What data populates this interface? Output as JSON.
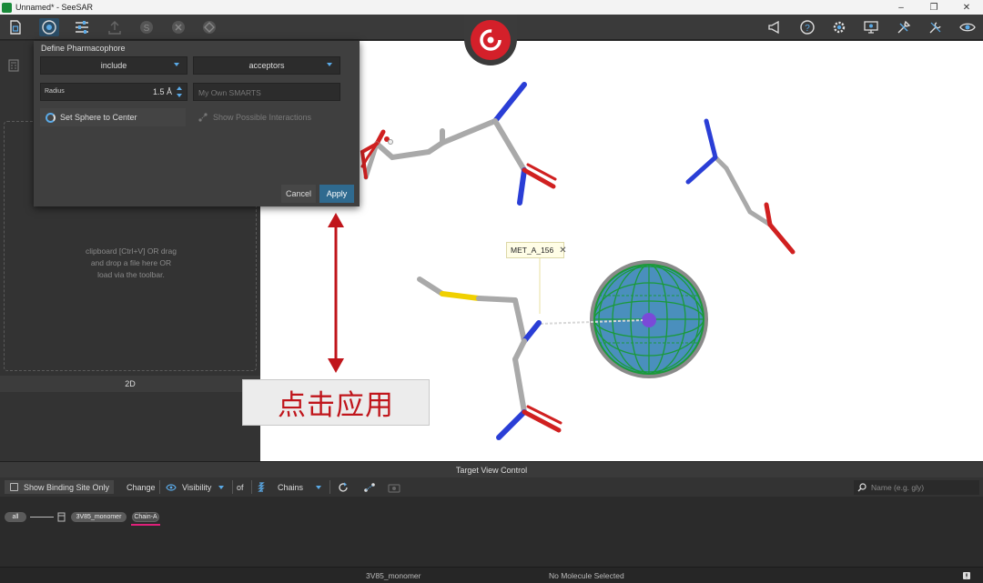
{
  "window": {
    "title": "Unnamed* - SeeSAR",
    "controls": [
      "–",
      "❐",
      "✕"
    ]
  },
  "toolbar": {
    "left_icons": [
      "file-icon",
      "pharmacophore-icon",
      "settings-sliders-icon",
      "upload-icon",
      "dollar-icon",
      "delete-icon",
      "diamond-icon"
    ],
    "right_icons": [
      "announce-icon",
      "help-icon",
      "gear-icon",
      "monitor-icon",
      "tools-icon",
      "wrench-icon",
      "eye-icon"
    ],
    "active_icon": "pharmacophore-icon"
  },
  "dialog": {
    "title": "Define Pharmacophore",
    "mode_dropdown": "include",
    "type_dropdown": "acceptors",
    "radius_label": "Radius",
    "radius_value": "1.5 Å",
    "smarts_placeholder": "My Own SMARTS",
    "sphere_button": "Set Sphere to Center",
    "interactions_button": "Show Possible Interactions",
    "cancel": "Cancel",
    "apply": "Apply"
  },
  "left_panel": {
    "drop_text": [
      "clipboard [Ctrl+V] OR drag",
      "and drop a file here OR",
      "load via the toolbar."
    ],
    "label_2d": "2D"
  },
  "viewport": {
    "residue_label": "MET_A_156",
    "close": "✕"
  },
  "annotation": {
    "text": "点击应用",
    "color": "#c0151b"
  },
  "target_view": {
    "header": "Target View Control",
    "show_binding_site": "Show Binding Site Only",
    "change": "Change",
    "visibility": "Visibility",
    "of": "of",
    "chains": "Chains",
    "search_placeholder": "Name (e.g. gly)",
    "tree": {
      "all": "all",
      "monomer": "3V85_monomer",
      "chain": "Chain-A"
    }
  },
  "status": {
    "molecule": "3V85_monomer",
    "selection": "No Molecule Selected"
  },
  "colors": {
    "accent": "#5aa9e6",
    "apply": "#2f6a8f",
    "brand": "#d4202a"
  }
}
